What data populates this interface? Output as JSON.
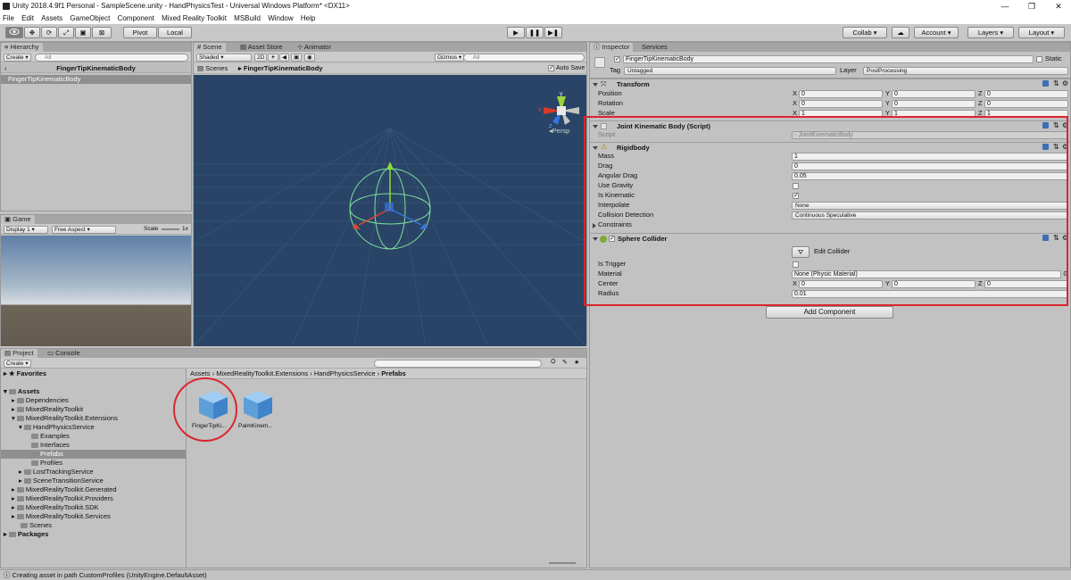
{
  "window": {
    "title": "Unity 2018.4.9f1 Personal - SampleScene.unity - HandPhysicsTest - Universal Windows Platform* <DX11>",
    "minimize": "—",
    "maximize": "❐",
    "close": "✕"
  },
  "menu": [
    "File",
    "Edit",
    "Assets",
    "GameObject",
    "Component",
    "Mixed Reality Toolkit",
    "MSBuild",
    "Window",
    "Help"
  ],
  "toolbar": {
    "pivot": "Pivot",
    "local": "Local",
    "collab": "Collab",
    "account": "Account",
    "layers": "Layers",
    "layout": "Layout"
  },
  "hierarchy": {
    "tab": "Hierarchy",
    "create": "Create",
    "search_placeholder": "All",
    "scene_title": "FingerTipKinematicBody",
    "item": "FingerTipKinematicBody"
  },
  "game": {
    "tab": "Game",
    "display": "Display 1",
    "aspect": "Free Aspect",
    "scale": "Scale",
    "scale_value": "1x"
  },
  "scene": {
    "tabs": [
      "Scene",
      "Asset Store",
      "Animator"
    ],
    "shaded": "Shaded",
    "mode2d": "2D",
    "gizmos": "Gizmos",
    "search_placeholder": "All",
    "breadcrumb_root": "Scenes",
    "breadcrumb_item": "FingerTipKinematicBody",
    "autosave": "Auto Save",
    "persp": "Persp",
    "gizmo_axes": {
      "x": "x",
      "y": "y",
      "z": "z"
    }
  },
  "inspector": {
    "tabs": [
      "Inspector",
      "Services"
    ],
    "object_name": "FingerTipKinematicBody",
    "static": "Static",
    "tag_label": "Tag",
    "tag_value": "Untagged",
    "layer_label": "Layer",
    "layer_value": "PostProcessing",
    "transform": {
      "title": "Transform",
      "rows": [
        {
          "label": "Position",
          "x": "0",
          "y": "0",
          "z": "0"
        },
        {
          "label": "Rotation",
          "x": "0",
          "y": "0",
          "z": "0"
        },
        {
          "label": "Scale",
          "x": "1",
          "y": "1",
          "z": "1"
        }
      ]
    },
    "joint": {
      "title": "Joint Kinematic Body (Script)",
      "script_label": "Script",
      "script_value": "JointKinematicBody"
    },
    "rigidbody": {
      "title": "Rigidbody",
      "mass_label": "Mass",
      "mass": "1",
      "drag_label": "Drag",
      "drag": "0",
      "angular_drag_label": "Angular Drag",
      "angular_drag": "0.05",
      "use_gravity_label": "Use Gravity",
      "is_kinematic_label": "Is Kinematic",
      "interpolate_label": "Interpolate",
      "interpolate": "None",
      "collision_label": "Collision Detection",
      "collision": "Continuous Speculative",
      "constraints_label": "Constraints"
    },
    "sphere": {
      "title": "Sphere Collider",
      "edit_collider": "Edit Collider",
      "is_trigger_label": "Is Trigger",
      "material_label": "Material",
      "material": "None (Physic Material)",
      "center_label": "Center",
      "cx": "0",
      "cy": "0",
      "cz": "0",
      "radius_label": "Radius",
      "radius": "0.01"
    },
    "axis": {
      "x": "X",
      "y": "Y",
      "z": "Z"
    },
    "add_component": "Add Component"
  },
  "project": {
    "tabs": [
      "Project",
      "Console"
    ],
    "create": "Create",
    "favorites": "Favorites",
    "assets": "Assets",
    "packages": "Packages",
    "tree": [
      {
        "label": "Dependencies",
        "depth": 1
      },
      {
        "label": "MixedRealityToolkit",
        "depth": 1
      },
      {
        "label": "MixedRealityToolkit.Extensions",
        "depth": 1
      },
      {
        "label": "HandPhysicsService",
        "depth": 2
      },
      {
        "label": "Examples",
        "depth": 3
      },
      {
        "label": "Interfaces",
        "depth": 3
      },
      {
        "label": "Prefabs",
        "depth": 3
      },
      {
        "label": "Profiles",
        "depth": 3
      },
      {
        "label": "LostTrackingService",
        "depth": 2
      },
      {
        "label": "SceneTransitionService",
        "depth": 2
      },
      {
        "label": "MixedRealityToolkit.Generated",
        "depth": 1
      },
      {
        "label": "MixedRealityToolkit.Providers",
        "depth": 1
      },
      {
        "label": "MixedRealityToolkit.SDK",
        "depth": 1
      },
      {
        "label": "MixedRealityToolkit.Services",
        "depth": 1
      },
      {
        "label": "Scenes",
        "depth": 1
      }
    ],
    "breadcrumb": [
      "Assets",
      "MixedRealityToolkit.Extensions",
      "HandPhysicsService",
      "Prefabs"
    ],
    "assets_grid": [
      "FingerTipKi...",
      "PalmKinem..."
    ]
  },
  "status": {
    "message": "Creating asset in path CustomProfiles (UnityEngine.DefaultAsset)"
  },
  "colors": {
    "highlight_red": "#d9262f",
    "scene_bg": "#284566",
    "selection": "#8fa6c4"
  }
}
